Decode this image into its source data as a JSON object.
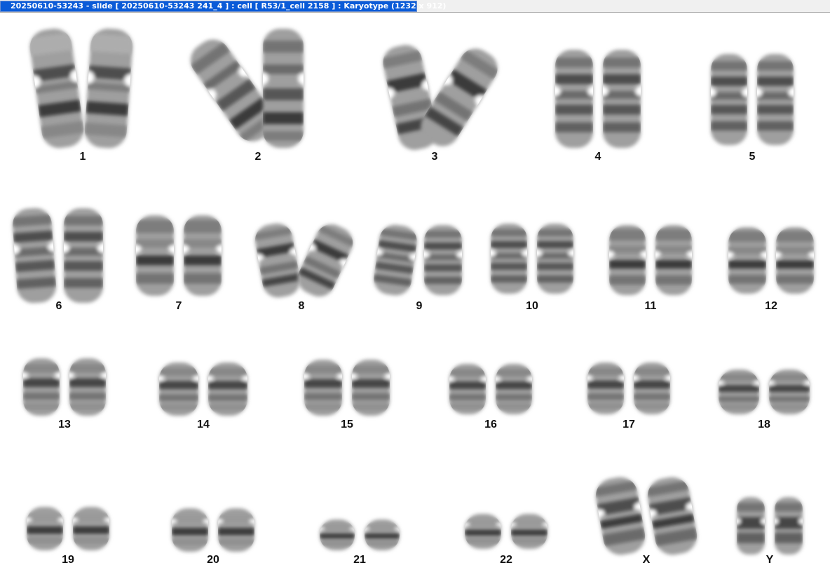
{
  "window": {
    "title": "20250610-53243 - slide [ 20250610-53243 241_4 ] : cell [ R53/1_cell 2158 ] : Karyotype  (1232 x 912)"
  },
  "colors": {
    "title_tab": "#0a5bd8",
    "background": "#ffffff",
    "chromosome_dark": "#1a1a1a",
    "chromosome_light": "#d8d8d8"
  },
  "karyotype": {
    "rows": [
      {
        "pairs": [
          {
            "label": "1"
          },
          {
            "label": "2"
          },
          {
            "label": "3"
          },
          {
            "label": "4"
          },
          {
            "label": "5"
          }
        ]
      },
      {
        "pairs": [
          {
            "label": "6"
          },
          {
            "label": "7"
          },
          {
            "label": "8"
          },
          {
            "label": "9"
          },
          {
            "label": "10"
          },
          {
            "label": "11"
          },
          {
            "label": "12"
          }
        ]
      },
      {
        "pairs": [
          {
            "label": "13"
          },
          {
            "label": "14"
          },
          {
            "label": "15"
          },
          {
            "label": "16"
          },
          {
            "label": "17"
          },
          {
            "label": "18"
          }
        ]
      },
      {
        "pairs": [
          {
            "label": "19"
          },
          {
            "label": "20"
          },
          {
            "label": "21"
          },
          {
            "label": "22"
          },
          {
            "label": "X"
          },
          {
            "label": "Y"
          }
        ]
      }
    ]
  }
}
